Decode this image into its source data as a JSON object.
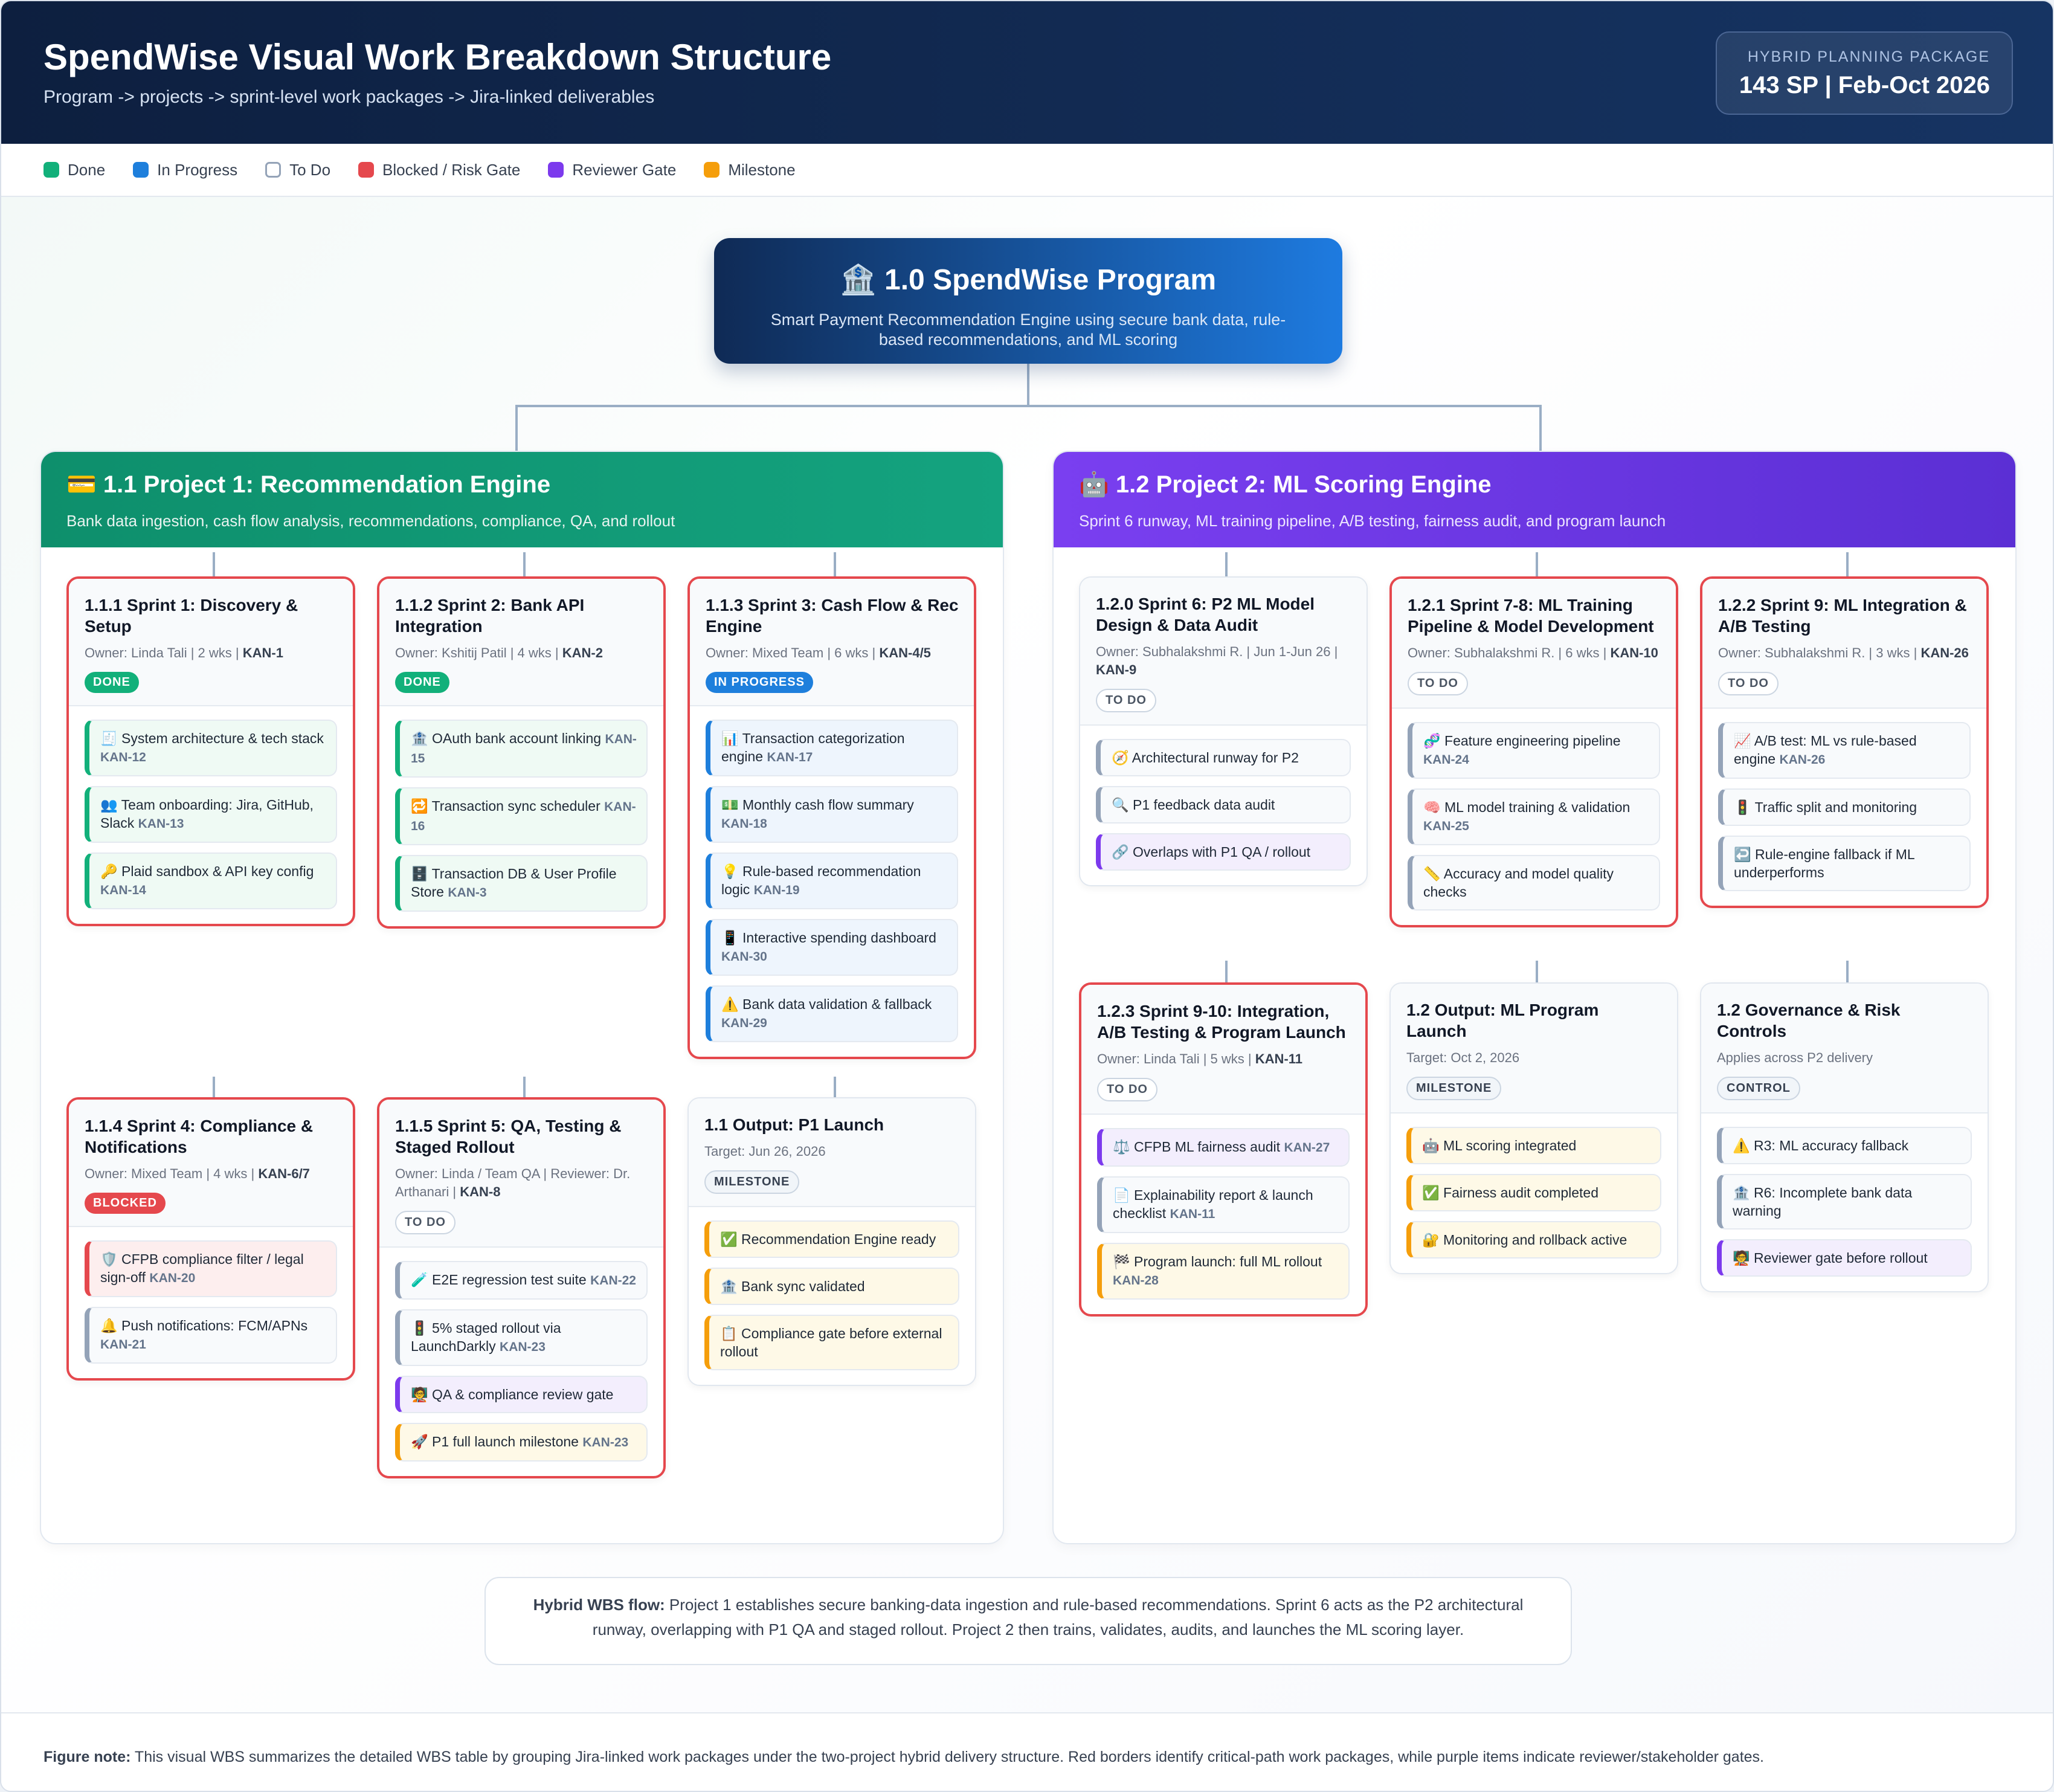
{
  "header": {
    "title": "SpendWise Visual Work Breakdown Structure",
    "subtitle": "Program -> projects -> sprint-level work packages -> Jira-linked deliverables",
    "package_label": "HYBRID PLANNING PACKAGE",
    "package_value": "143 SP | Feb-Oct 2026"
  },
  "legend": [
    {
      "label": "Done",
      "color": "#12b07a"
    },
    {
      "label": "In Progress",
      "color": "#1e7fdc"
    },
    {
      "label": "To Do",
      "color": "#ffffff"
    },
    {
      "label": "Blocked / Risk Gate",
      "color": "#e5484d"
    },
    {
      "label": "Reviewer Gate",
      "color": "#7c3aed"
    },
    {
      "label": "Milestone",
      "color": "#f59e0b"
    }
  ],
  "root": {
    "title": "🏦 1.0 SpendWise Program",
    "desc": "Smart Payment Recommendation Engine using secure bank data, rule-based recommendations, and ML scoring"
  },
  "projects": [
    {
      "title": "💳 1.1 Project 1: Recommendation Engine",
      "desc": "Bank data ingestion, cash flow analysis, recommendations, compliance, QA, and rollout",
      "color": "#0f9b74",
      "cards": [
        {
          "title": "1.1.1 Sprint 1: Discovery & Setup",
          "owner": "Owner: Linda Tali | 2 wks | ",
          "kan": "KAN-1",
          "badge": "DONE",
          "status": "done",
          "critical": true,
          "items": [
            {
              "text": "🧾 System architecture & tech stack ",
              "kan": "KAN-12",
              "type": "done"
            },
            {
              "text": "👥 Team onboarding: Jira, GitHub, Slack ",
              "kan": "KAN-13",
              "type": "done"
            },
            {
              "text": "🔑 Plaid sandbox & API key config ",
              "kan": "KAN-14",
              "type": "done"
            }
          ]
        },
        {
          "title": "1.1.2 Sprint 2: Bank API Integration",
          "owner": "Owner: Kshitij Patil | 4 wks | ",
          "kan": "KAN-2",
          "badge": "DONE",
          "status": "done",
          "critical": true,
          "items": [
            {
              "text": "🏦 OAuth bank account linking ",
              "kan": "KAN-15",
              "type": "done"
            },
            {
              "text": "🔁 Transaction sync scheduler ",
              "kan": "KAN-16",
              "type": "done"
            },
            {
              "text": "🗄️ Transaction DB & User Profile Store ",
              "kan": "KAN-3",
              "type": "done"
            }
          ]
        },
        {
          "title": "1.1.3 Sprint 3: Cash Flow & Rec Engine",
          "owner": "Owner: Mixed Team | 6 wks | ",
          "kan": "KAN-4/5",
          "badge": "IN PROGRESS",
          "status": "prog",
          "critical": true,
          "items": [
            {
              "text": "📊 Transaction categorization engine ",
              "kan": "KAN-17",
              "type": "prog"
            },
            {
              "text": "💵 Monthly cash flow summary ",
              "kan": "KAN-18",
              "type": "prog"
            },
            {
              "text": "💡 Rule-based recommendation logic ",
              "kan": "KAN-19",
              "type": "prog"
            },
            {
              "text": "📱 Interactive spending dashboard ",
              "kan": "KAN-30",
              "type": "prog"
            },
            {
              "text": "⚠️ Bank data validation & fallback ",
              "kan": "KAN-29",
              "type": "prog"
            }
          ]
        },
        {
          "title": "1.1.4 Sprint 4: Compliance & Notifications",
          "owner": "Owner: Mixed Team | 4 wks | ",
          "kan": "KAN-6/7",
          "badge": "BLOCKED",
          "status": "blk",
          "critical": true,
          "items": [
            {
              "text": "🛡️ CFPB compliance filter / legal sign-off ",
              "kan": "KAN-20",
              "type": "blk"
            },
            {
              "text": "🔔 Push notifications: FCM/APNs ",
              "kan": "KAN-21",
              "type": "todo"
            }
          ]
        },
        {
          "title": "1.1.5 Sprint 5: QA, Testing & Staged Rollout",
          "owner": "Owner: Linda / Team QA | Reviewer: Dr. Arthanari | ",
          "kan": "KAN-8",
          "badge": "TO DO",
          "status": "todo",
          "critical": true,
          "items": [
            {
              "text": "🧪 E2E regression test suite ",
              "kan": "KAN-22",
              "type": "todo"
            },
            {
              "text": "🚦 5% staged rollout via LaunchDarkly ",
              "kan": "KAN-23",
              "type": "todo"
            },
            {
              "text": "🧑‍🏫 QA & compliance review gate",
              "kan": "",
              "type": "rev"
            },
            {
              "text": "🚀 P1 full launch milestone ",
              "kan": "KAN-23",
              "type": "ms"
            }
          ]
        },
        {
          "title": "1.1 Output: P1 Launch",
          "owner": "Target: Jun 26, 2026",
          "kan": "",
          "badge": "MILESTONE",
          "status": "ms",
          "critical": false,
          "items": [
            {
              "text": "✅ Recommendation Engine ready",
              "kan": "",
              "type": "ms"
            },
            {
              "text": "🏦 Bank sync validated",
              "kan": "",
              "type": "ms"
            },
            {
              "text": "📋 Compliance gate before external rollout",
              "kan": "",
              "type": "ms"
            }
          ]
        }
      ]
    },
    {
      "title": "🤖 1.2 Project 2: ML Scoring Engine",
      "desc": "Sprint 6 runway, ML training pipeline, A/B testing, fairness audit, and program launch",
      "color": "#6d35e8",
      "cards": [
        {
          "title": "1.2.0 Sprint 6: P2 ML Model Design & Data Audit",
          "owner": "Owner: Subhalakshmi R. | Jun 1-Jun 26 | ",
          "kan": "KAN-9",
          "badge": "TO DO",
          "status": "todo",
          "critical": false,
          "items": [
            {
              "text": "🧭 Architectural runway for P2",
              "kan": "",
              "type": "todo"
            },
            {
              "text": "🔍 P1 feedback data audit",
              "kan": "",
              "type": "todo"
            },
            {
              "text": "🔗 Overlaps with P1 QA / rollout",
              "kan": "",
              "type": "rev"
            }
          ]
        },
        {
          "title": "1.2.1 Sprint 7-8: ML Training Pipeline & Model Development",
          "owner": "Owner: Subhalakshmi R. | 6 wks | ",
          "kan": "KAN-10",
          "badge": "TO DO",
          "status": "todo",
          "critical": true,
          "items": [
            {
              "text": "🧬 Feature engineering pipeline ",
              "kan": "KAN-24",
              "type": "todo"
            },
            {
              "text": "🧠 ML model training & validation ",
              "kan": "KAN-25",
              "type": "todo"
            },
            {
              "text": "📏 Accuracy and model quality checks",
              "kan": "",
              "type": "todo"
            }
          ]
        },
        {
          "title": "1.2.2 Sprint 9: ML Integration & A/B Testing",
          "owner": "Owner: Subhalakshmi R. | 3 wks | ",
          "kan": "KAN-26",
          "badge": "TO DO",
          "status": "todo",
          "critical": true,
          "items": [
            {
              "text": "📈 A/B test: ML vs rule-based engine ",
              "kan": "KAN-26",
              "type": "todo"
            },
            {
              "text": "🚦 Traffic split and monitoring",
              "kan": "",
              "type": "todo"
            },
            {
              "text": "↩️ Rule-engine fallback if ML underperforms",
              "kan": "",
              "type": "todo"
            }
          ]
        },
        {
          "title": "1.2.3 Sprint 9-10: Integration, A/B Testing & Program Launch",
          "owner": "Owner: Linda Tali | 5 wks | ",
          "kan": "KAN-11",
          "badge": "TO DO",
          "status": "todo",
          "critical": true,
          "items": [
            {
              "text": "⚖️ CFPB ML fairness audit ",
              "kan": "KAN-27",
              "type": "rev"
            },
            {
              "text": "📄 Explainability report & launch checklist ",
              "kan": "KAN-11",
              "type": "todo"
            },
            {
              "text": "🏁 Program launch: full ML rollout ",
              "kan": "KAN-28",
              "type": "ms"
            }
          ]
        },
        {
          "title": "1.2 Output: ML Program Launch",
          "owner": "Target: Oct 2, 2026",
          "kan": "",
          "badge": "MILESTONE",
          "status": "ms",
          "critical": false,
          "items": [
            {
              "text": "🤖 ML scoring integrated",
              "kan": "",
              "type": "ms"
            },
            {
              "text": "✅ Fairness audit completed",
              "kan": "",
              "type": "ms"
            },
            {
              "text": "🔐 Monitoring and rollback active",
              "kan": "",
              "type": "ms"
            }
          ]
        },
        {
          "title": "1.2 Governance & Risk Controls",
          "owner": "Applies across P2 delivery",
          "kan": "",
          "badge": "CONTROL",
          "status": "ms",
          "critical": false,
          "items": [
            {
              "text": "⚠️ R3: ML accuracy fallback",
              "kan": "",
              "type": "todo"
            },
            {
              "text": "🏦 R6: Incomplete bank data warning",
              "kan": "",
              "type": "todo"
            },
            {
              "text": "🧑‍🏫 Reviewer gate before rollout",
              "kan": "",
              "type": "rev"
            }
          ]
        }
      ]
    }
  ],
  "flow": {
    "bold": "Hybrid WBS flow:",
    "text": " Project 1 establishes secure banking-data ingestion and rule-based recommendations. Sprint 6 acts as the P2 architectural runway, overlapping with P1 QA and staged rollout. Project 2 then trains, validates, audits, and launches the ML scoring layer."
  },
  "footer": {
    "bold": "Figure note:",
    "text": " This visual WBS summarizes the detailed WBS table by grouping Jira-linked work packages under the two-project hybrid delivery structure. Red borders identify critical-path work packages, while purple items indicate reviewer/stakeholder gates."
  }
}
